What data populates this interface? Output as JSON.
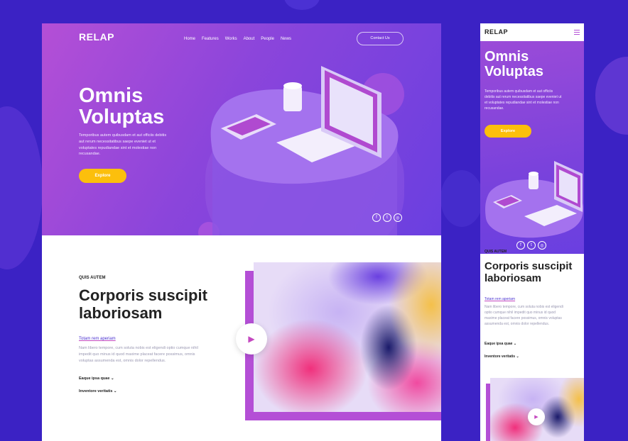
{
  "brand": {
    "logo": "RELAP",
    "accent": "#fcbf0c",
    "hero_start": "#b44fd6",
    "hero_end": "#6a3fe0"
  },
  "nav": {
    "items": [
      {
        "label": "Home"
      },
      {
        "label": "Features"
      },
      {
        "label": "Works"
      },
      {
        "label": "About"
      },
      {
        "label": "People"
      },
      {
        "label": "News"
      }
    ],
    "contact_label": "Contact Us"
  },
  "hero": {
    "title_line1": "Omnis",
    "title_line2": "Voluptas",
    "lead_lines": [
      "Temporibus autem quibusdam et aut officiis debitis",
      "aut rerum necessitatibus saepe eveniet ut et",
      "voluptates repudiandae sint et molestiae non",
      "recusandae."
    ],
    "button_label": "Explore"
  },
  "mobile_hero": {
    "lead_lines": [
      "Temporibus autem quibusdam et aut officiis",
      "debitis aut rerum necessitatibus saepe eveniet ut",
      "et voluptates repudiandae sint et molestiae non",
      "recusandae."
    ]
  },
  "social": [
    "facebook-icon",
    "twitter-icon",
    "instagram-icon"
  ],
  "section": {
    "eyebrow": "QUIS AUTEM",
    "title_line1": "Corporis suscipit",
    "title_line2": "laboriosam",
    "link_label": "Totam rem aperiam",
    "body_lines": [
      "Nam libero tempore, cum soluta nobis est eligendi optio cumque nihil",
      "impedit quo minus id quod maxime placeat facere possimus, omnis",
      "voluptas assumenda est, omnis dolor repellendus."
    ],
    "accordion": [
      {
        "label": "Eaque ipsa quae"
      },
      {
        "label": "Inventore veritatis"
      }
    ]
  },
  "mobile_section": {
    "body_lines": [
      "Nam libero tempore, cum soluta nobis est eligendi",
      "optio cumque nihil impedit quo minus id quod",
      "maxime placeat facere possimus, omnis voluptas",
      "assumenda est, omnis dolor repellendus."
    ]
  }
}
